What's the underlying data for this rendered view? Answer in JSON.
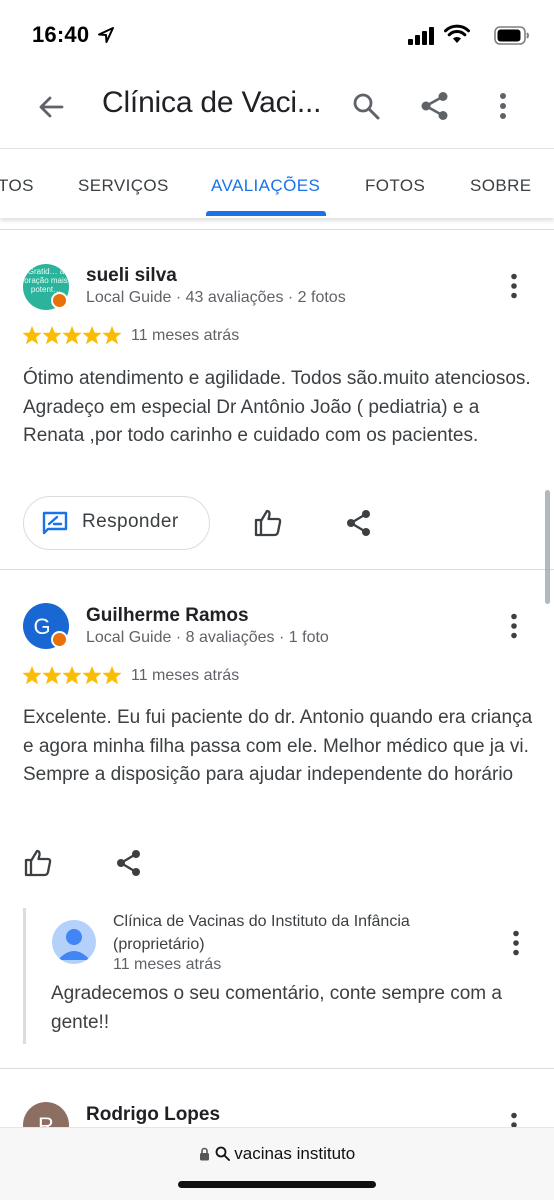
{
  "status_bar": {
    "time": "16:40"
  },
  "app_bar": {
    "title": "Clínica de Vaci..."
  },
  "tabs": [
    {
      "label": "TOS"
    },
    {
      "label": "SERVIÇOS"
    },
    {
      "label": "AVALIAÇÕES",
      "active": true
    },
    {
      "label": "FOTOS"
    },
    {
      "label": "SOBRE"
    }
  ],
  "reviews": [
    {
      "name": "sueli silva",
      "meta": "Local Guide · 43 avaliações · 2 fotos",
      "rating": 5,
      "date": "11 meses atrás",
      "text": "Ótimo atendimento e agilidade. Todos são.muito atenciosos. Agradeço em especial Dr Antônio João ( pediatria) e a Renata ,por todo carinho e cuidado com os pacientes.",
      "avatar_text": "Gratid… a oração mais potent…",
      "respond_label": "Responder"
    },
    {
      "name": "Guilherme Ramos",
      "initial": "G",
      "meta": "Local Guide · 8 avaliações · 1 foto",
      "rating": 5,
      "date": "11 meses atrás",
      "text": "Excelente. Eu fui paciente do dr. Antonio quando era criança e agora minha filha passa com ele. Melhor médico que ja vi. Sempre a disposição para ajudar independente do horário",
      "owner_reply": {
        "name": "Clínica de Vacinas do Instituto da Infância (proprietário)",
        "date": "11 meses atrás",
        "text": "Agradecemos o seu comentário, conte sempre com a gente!!"
      }
    },
    {
      "name": "Rodrigo Lopes",
      "initial": "R"
    }
  ],
  "url_bar": {
    "text": "vacinas instituto"
  },
  "colors": {
    "accent": "#1a73e8",
    "star": "#fbbc04",
    "local_guide_badge": "#e8710a",
    "avatar_guilherme": "#1967d2",
    "avatar_rodrigo": "#8d6e63"
  },
  "icons": [
    "location-arrow-icon",
    "cellular-signal-icon",
    "wifi-icon",
    "battery-icon",
    "back-arrow-icon",
    "search-icon",
    "share-icon",
    "more-vert-icon",
    "star-icon",
    "reply-icon",
    "thumbs-up-icon",
    "person-icon",
    "lock-icon"
  ]
}
